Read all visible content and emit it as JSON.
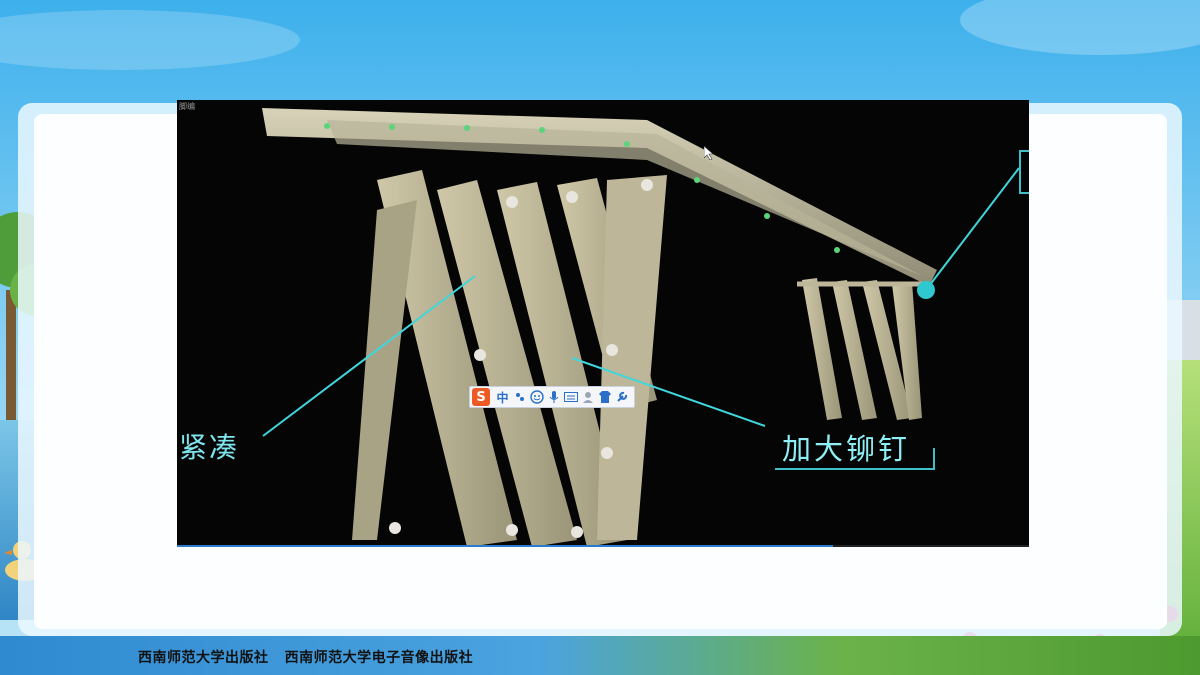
{
  "video": {
    "corner_label": "脚编",
    "callout_left": "紧凑",
    "callout_right": "加大铆钉",
    "playback_progress": 0.77
  },
  "ime_toolbar": {
    "logo": "S",
    "mode_label": "中",
    "items": [
      "punctuation-icon",
      "emoji-icon",
      "microphone-icon",
      "keyboard-icon",
      "user-icon",
      "skin-icon",
      "settings-icon"
    ]
  },
  "footer": {
    "publisher_text": "西南师范大学出版社   西南师范大学电子音像出版社"
  },
  "colors": {
    "accent_cyan": "#3fd6dc",
    "ime_logo": "#ee5a24"
  }
}
